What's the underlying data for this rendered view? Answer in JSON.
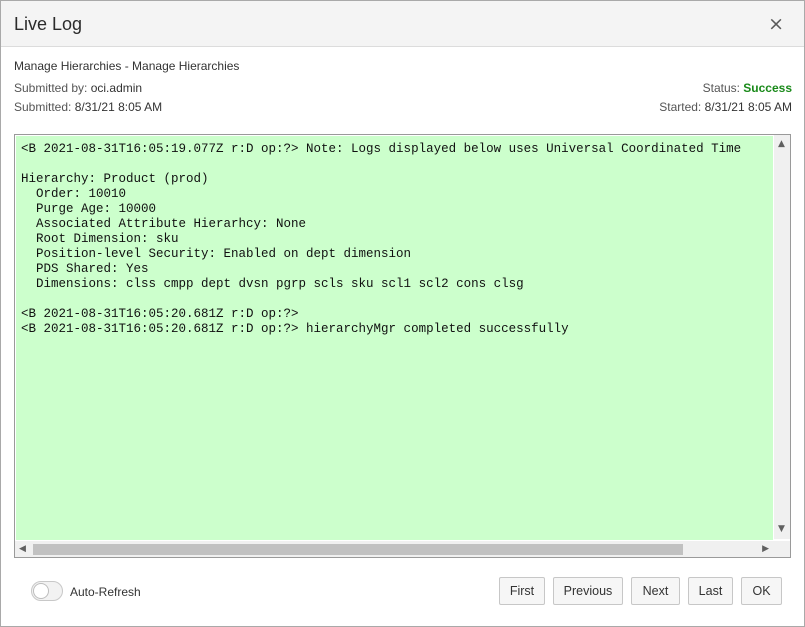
{
  "dialog": {
    "title": "Live Log",
    "close_glyph": "×"
  },
  "info": {
    "job_title": "Manage Hierarchies - Manage Hierarchies",
    "submitted_by_label": "Submitted by: ",
    "submitted_by_value": "oci.admin",
    "submitted_label": "Submitted: ",
    "submitted_value": "8/31/21 8:05 AM",
    "status_label": "Status: ",
    "status_value": "Success",
    "started_label": "Started: ",
    "started_value": "8/31/21 8:05 AM"
  },
  "log": {
    "lines": [
      "<B 2021-08-31T16:05:19.077Z r:D op:?> Note: Logs displayed below uses Universal Coordinated Time",
      "",
      "Hierarchy: Product (prod)",
      "  Order: 10010",
      "  Purge Age: 10000",
      "  Associated Attribute Hierarhcy: None",
      "  Root Dimension: sku",
      "  Position-level Security: Enabled on dept dimension",
      "  PDS Shared: Yes",
      "  Dimensions: clss cmpp dept dvsn pgrp scls sku scl1 scl2 cons clsg",
      "",
      "<B 2021-08-31T16:05:20.681Z r:D op:?>",
      "<B 2021-08-31T16:05:20.681Z r:D op:?> hierarchyMgr completed successfully"
    ],
    "colors": {
      "background": "#ccffcc"
    }
  },
  "footer": {
    "auto_refresh_label": "Auto-Refresh",
    "auto_refresh_on": false,
    "buttons": {
      "first": "First",
      "previous": "Previous",
      "next": "Next",
      "last": "Last",
      "ok": "OK"
    }
  },
  "colors": {
    "success": "#1a8a1a"
  }
}
